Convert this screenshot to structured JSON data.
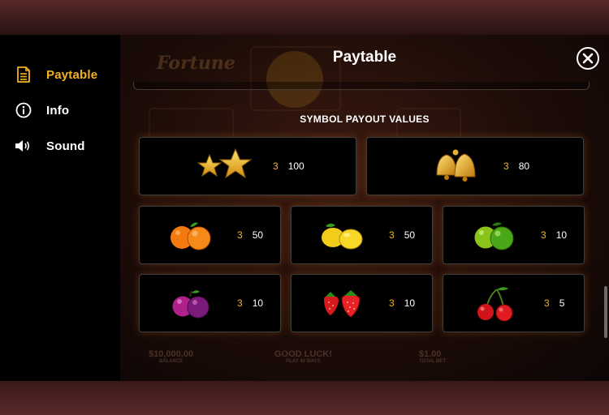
{
  "sidebar": {
    "items": [
      {
        "label": "Paytable",
        "icon": "document-icon",
        "active": true
      },
      {
        "label": "Info",
        "icon": "info-icon",
        "active": false
      },
      {
        "label": "Sound",
        "icon": "speaker-icon",
        "active": false
      }
    ]
  },
  "panel": {
    "title": "Paytable",
    "section_title": "SYMBOL PAYOUT VALUES"
  },
  "payouts": [
    {
      "symbol": "stars",
      "count": "3",
      "value": "100"
    },
    {
      "symbol": "bells",
      "count": "3",
      "value": "80"
    },
    {
      "symbol": "oranges",
      "count": "3",
      "value": "50"
    },
    {
      "symbol": "lemons",
      "count": "3",
      "value": "50"
    },
    {
      "symbol": "limes",
      "count": "3",
      "value": "10"
    },
    {
      "symbol": "plums",
      "count": "3",
      "value": "10"
    },
    {
      "symbol": "strawberries",
      "count": "3",
      "value": "10"
    },
    {
      "symbol": "cherries",
      "count": "3",
      "value": "5"
    }
  ],
  "background": {
    "logo_text": "Fortune",
    "balance": "$10,000.00",
    "balance_label": "BALANCE",
    "message": "GOOD LUCK!",
    "message_sub": "PLAY 40 WAYS",
    "bet": "$1.00",
    "bet_label": "TOTAL BET"
  },
  "colors": {
    "accent": "#f5b21e",
    "card_bg": "#000000",
    "sidebar_bg": "#000000"
  }
}
